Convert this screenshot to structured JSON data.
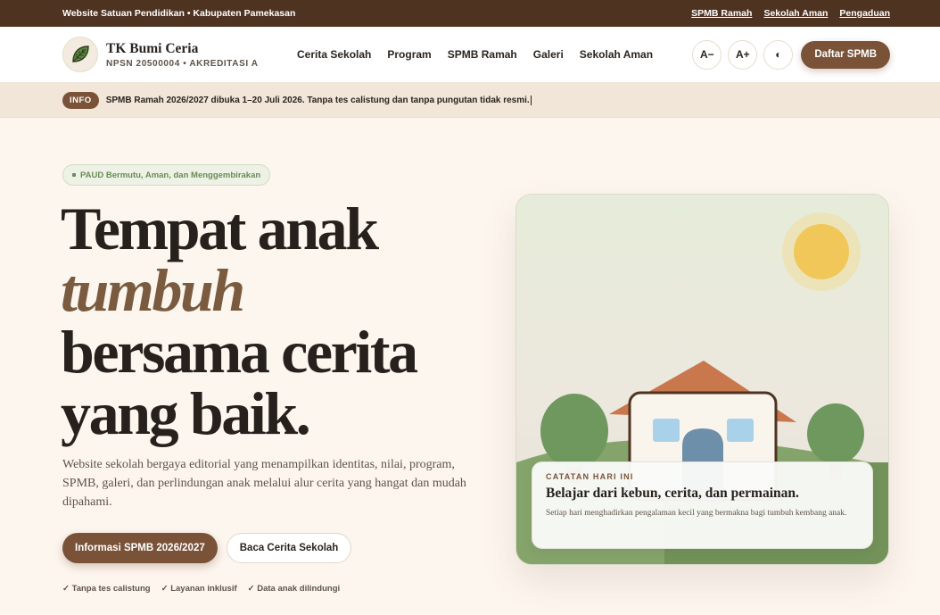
{
  "topbar": {
    "tagline": "Website Satuan Pendidikan • Kabupaten Pamekasan",
    "links": [
      "SPMB Ramah",
      "Sekolah Aman",
      "Pengaduan"
    ]
  },
  "header": {
    "school_name": "TK Bumi Ceria",
    "school_meta": "NPSN 20500004 • AKREDITASI A",
    "nav": [
      "Cerita Sekolah",
      "Program",
      "SPMB Ramah",
      "Galeri",
      "Sekolah Aman"
    ],
    "font_decrease": "A−",
    "font_increase": "A+",
    "contrast_toggle": "◐",
    "cta": "Daftar SPMB"
  },
  "info": {
    "badge": "INFO",
    "text": "SPMB Ramah 2026/2027 dibuka 1–20 Juli 2026. Tanpa tes calistung dan tanpa pungutan tidak resmi."
  },
  "hero": {
    "pill": "PAUD Bermutu, Aman, dan Menggembirakan",
    "headline_1": "Tempat anak",
    "headline_accent": "tumbuh",
    "headline_2": "bersama cerita",
    "headline_3": "yang baik.",
    "description": "Website sekolah bergaya editorial yang menampilkan identitas, nilai, program, SPMB, galeri, dan perlindungan anak melalui alur cerita yang hangat dan mudah dipahami.",
    "primary_button": "Informasi SPMB 2026/2027",
    "secondary_button": "Baca Cerita Sekolah",
    "checks": [
      "✓ Tanpa tes calistung",
      "✓ Layanan inklusif",
      "✓ Data anak dilindungi"
    ]
  },
  "card": {
    "label": "CATATAN HARI INI",
    "title": "Belajar dari kebun, cerita, dan permainan.",
    "body": "Setiap hari menghadirkan pengalaman kecil yang bermakna bagi tumbuh kembang anak."
  },
  "colors": {
    "brown_dark": "#4e3321",
    "brown_accent": "#7a5238",
    "green": "#6a8a56",
    "sun": "#f2c75a"
  }
}
